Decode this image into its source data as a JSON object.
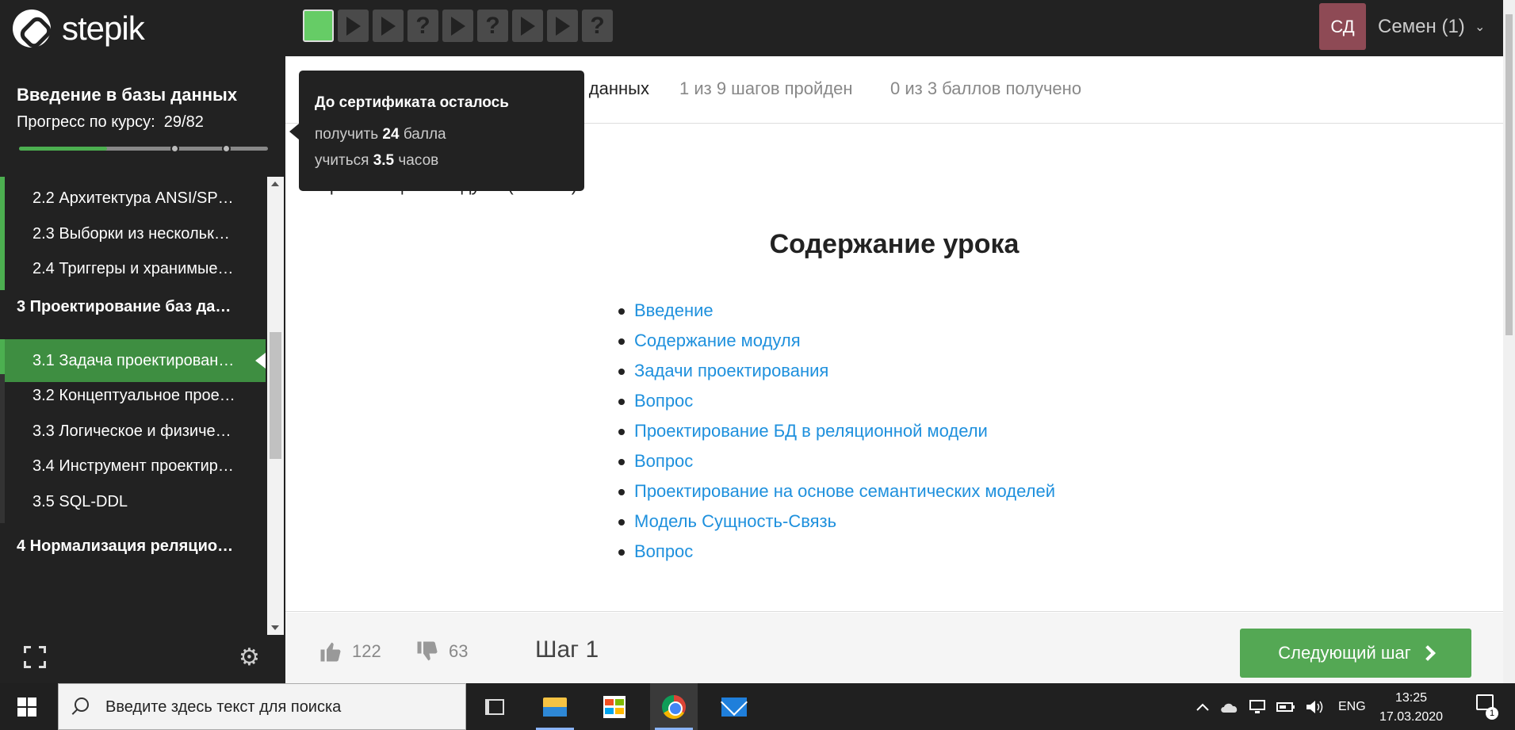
{
  "brand": {
    "logo_text": "stepik"
  },
  "step_nav": {
    "steps": [
      {
        "type": "active"
      },
      {
        "type": "play"
      },
      {
        "type": "play"
      },
      {
        "type": "quiz",
        "glyph": "?"
      },
      {
        "type": "play"
      },
      {
        "type": "quiz",
        "glyph": "?"
      },
      {
        "type": "play"
      },
      {
        "type": "play"
      },
      {
        "type": "quiz",
        "glyph": "?"
      }
    ]
  },
  "user": {
    "initials": "СД",
    "name": "Семен (1)",
    "chevron": "⌄",
    "avatar_color": "#8e4a55"
  },
  "sidebar": {
    "course_title": "Введение в базы данных",
    "progress_label": "Прогресс по курсу:",
    "progress_value": "29/82",
    "progress_fraction": 0.354,
    "items": [
      {
        "kind": "lesson",
        "label": "2.2  Архитектура ANSI/SP…",
        "state": "done"
      },
      {
        "kind": "lesson",
        "label": "2.3  Выборки из нескольк…",
        "state": "done"
      },
      {
        "kind": "lesson",
        "label": "2.4  Триггеры и хранимые…",
        "state": "done"
      },
      {
        "kind": "section",
        "label": "3  Проектирование баз да…"
      },
      {
        "kind": "lesson",
        "label": "3.1  Задача проектирован…",
        "state": "current"
      },
      {
        "kind": "lesson",
        "label": "3.2  Концептуальное прое…",
        "state": "todo"
      },
      {
        "kind": "lesson",
        "label": "3.3  Логическое и физиче…",
        "state": "todo"
      },
      {
        "kind": "lesson",
        "label": "3.4  Инструмент проектир…",
        "state": "todo"
      },
      {
        "kind": "lesson",
        "label": "3.5  SQL-DDL",
        "state": "todo"
      },
      {
        "kind": "section",
        "label": "4  Нормализация реляцио…"
      }
    ],
    "gear_glyph": "⚙"
  },
  "header": {
    "lesson_tail": "в данных",
    "steps_done": "1 из 9 шагов пройден",
    "points": "0 из 3 баллов  получено"
  },
  "tooltip": {
    "title": "До сертификата осталось",
    "line1_prefix": "получить",
    "line1_value": "24",
    "line1_suffix": "балла",
    "line2_prefix": "учиться",
    "line2_value": "3.5",
    "line2_suffix": "часов"
  },
  "content": {
    "intro_prefix": "Презентация к модулю (",
    "intro_link": "ссылка",
    "intro_suffix": ").",
    "title": "Содержание урока",
    "toc": [
      "Введение",
      "Содержание модуля",
      "Задачи проектирования",
      "Вопрос",
      "Проектирование БД в реляционной модели",
      "Вопрос",
      "Проектирование на основе семантических моделей",
      "Модель Сущность-Связь",
      "Вопрос"
    ]
  },
  "footer": {
    "likes": "122",
    "dislikes": "63",
    "step_label": "Шаг 1",
    "next_label": "Следующий шаг"
  },
  "taskbar": {
    "search_placeholder": "Введите здесь текст для поиска",
    "language": "ENG",
    "time": "13:25",
    "date": "17.03.2020",
    "notifications": "1"
  },
  "colors": {
    "accent_green": "#4caf50",
    "link_blue": "#1e90dd",
    "dark_bg": "#222222"
  }
}
